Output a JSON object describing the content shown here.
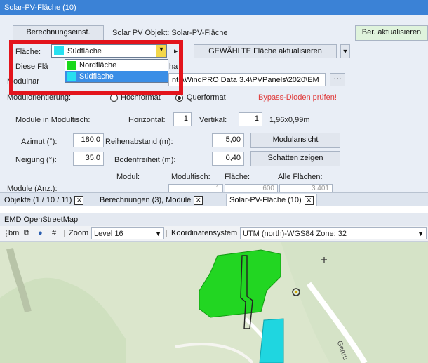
{
  "window": {
    "title": "Solar-PV-Fläche (10)"
  },
  "top": {
    "calc_button": "Berechnungseinst.",
    "object_label": "Solar PV Objekt: Solar-PV-Fläche",
    "update_button": "Ber. aktualisieren"
  },
  "area": {
    "label": "Fläche:",
    "selected": "Südfläche",
    "selected_color": "#27e0f0",
    "update_selected_button": "GEWÄHLTE Fläche aktualisieren",
    "options": [
      {
        "label": "Nordfläche",
        "color": "#18d81a"
      },
      {
        "label": "Südfläche",
        "color": "#27e0f0"
      }
    ]
  },
  "hidden_rows": {
    "row1_start": "Diese Flä",
    "row1_end": "ha",
    "row2_start": "Modulnar",
    "row2_path": "nts\\WindPRO Data 3.4\\PVPanels\\2020\\EM",
    "browse": "···"
  },
  "orientation": {
    "label": "Modulorientierung:",
    "portrait": "Hochformat",
    "landscape": "Querformat",
    "bypass_warning": "Bypass-Dioden prüfen!"
  },
  "table_modules": {
    "label": "Module in Modultisch:",
    "horizontal_label": "Horizontal:",
    "horizontal_value": "1",
    "vertical_label": "Vertikal:",
    "vertical_value": "1",
    "size": "1,96x0,99m"
  },
  "azimuth": {
    "label": "Azimut (°):",
    "value": "180,0",
    "row_spacing_label": "Reihenabstand (m):",
    "row_spacing_value": "5,00",
    "module_view_button": "Modulansicht"
  },
  "tilt": {
    "label": "Neigung (°):",
    "value": "35,0",
    "ground_clearance_label": "Bodenfreiheit (m):",
    "ground_clearance_value": "0,40",
    "shadow_button": "Schatten zeigen"
  },
  "summary": {
    "col_module": "Modul:",
    "col_table": "Modultisch:",
    "col_area": "Fläche:",
    "col_all": "Alle Flächen:",
    "row_label": "Module (Anz.):",
    "table_value": "1",
    "area_value": "600",
    "all_value": "3.401"
  },
  "tabs": [
    {
      "label": "Objekte (1 / 10 / 11)"
    },
    {
      "label": "Berechnungen (3), Module"
    },
    {
      "label": "Solar-PV-Fläche (10)"
    }
  ],
  "map_panel": {
    "title": "EMD OpenStreetMap",
    "toolbar_bmi": "bmi",
    "zoom_label": "Zoom",
    "zoom_value": "Level 16",
    "crs_label": "Koordinatensystem",
    "crs_value": "UTM (north)-WGS84 Zone: 32",
    "street_label": "Gertru"
  },
  "colors": {
    "north_area": "#22d622",
    "south_area": "#1fd6e0",
    "highlight": "#e3141c",
    "selection": "#3a8ee6"
  }
}
